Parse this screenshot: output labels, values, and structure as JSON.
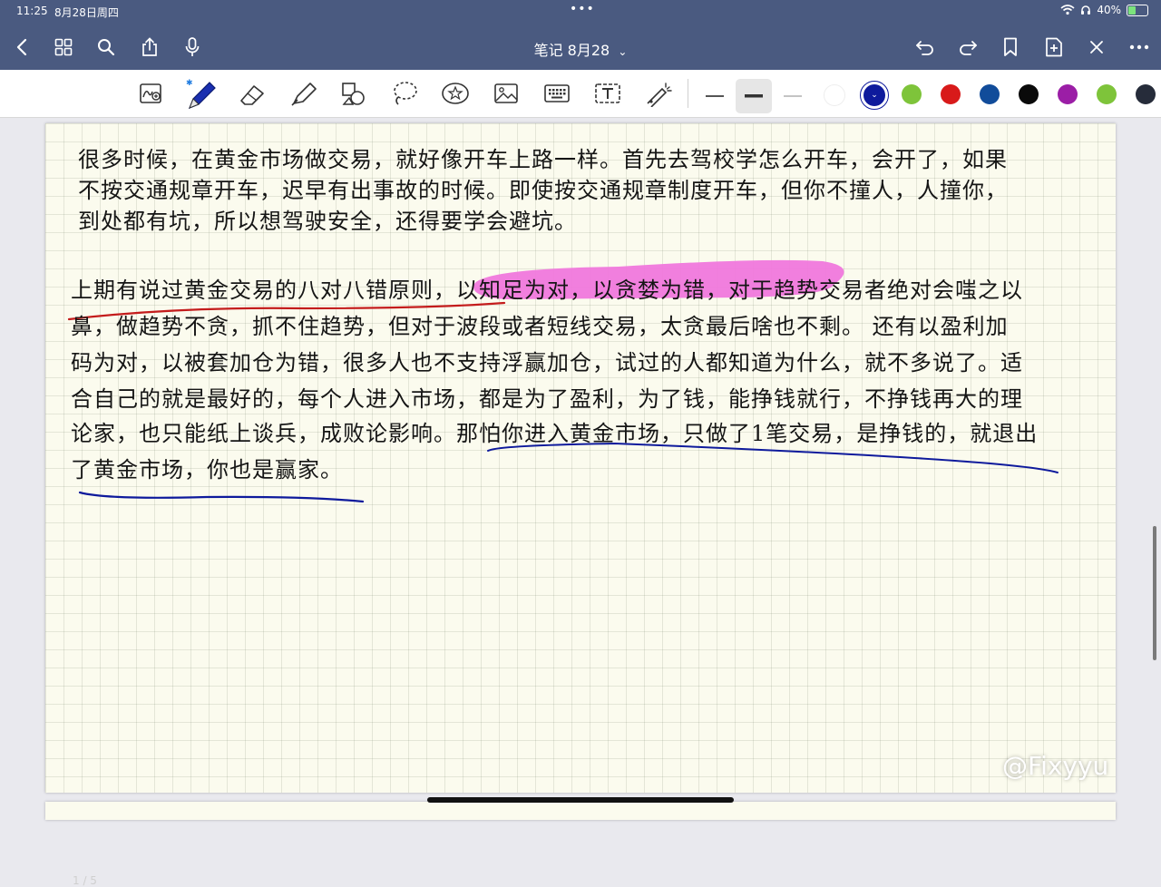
{
  "status_bar": {
    "time": "11:25",
    "date": "8月28日周四",
    "dots": "•••",
    "battery": "40%"
  },
  "nav": {
    "title": "笔记 8月28",
    "title_chevron": "⌄",
    "icons": [
      "back-icon",
      "grid-icon",
      "search-icon",
      "share-icon",
      "mic-icon",
      "undo-icon",
      "redo-icon",
      "bookmark-icon",
      "add-page-icon",
      "close-icon",
      "more-icon"
    ]
  },
  "toolbar": {
    "tools": [
      "zoom-window-icon",
      "pen-icon",
      "eraser-icon",
      "highlighter-icon",
      "shapes-icon",
      "lasso-icon",
      "sticker-icon",
      "image-icon",
      "keyboard-icon",
      "text-box-icon",
      "laser-pointer-icon"
    ],
    "colors": [
      "#ffffff",
      "#0e1a9c",
      "#7ec43a",
      "#d81a1a",
      "#114c9a",
      "#0a0a0a",
      "#9b1ea6",
      "#7ec43a",
      "#262c3a"
    ],
    "selected_color": "#0e1a9c"
  },
  "note": {
    "p1": [
      "很多时候，在黄金市场做交易，就好像开车上路一样。首先去驾校学怎么开车，会开了，如果",
      "不按交通规章开车，迟早有出事故的时候。即使按交通规章制度开车，但你不撞人，人撞你，",
      "到处都有坑，所以想驾驶安全，还得要学会避坑。"
    ],
    "p2_line1_a": "上期有说过黄金交易的八对八错原则，",
    "p2_line1_b": "以知足为对，以贪婪为错，",
    "p2_line1_c": "对于趋势交易者绝对会嗤之以",
    "p2": [
      "鼻，做趋势不贪，抓不住趋势，但对于波段或者短线交易，太贪最后啥也不剩。 还有以盈利加",
      "码为对，以被套加仓为错，很多人也不支持浮赢加仓，试过的人都知道为什么，就不多说了。适",
      "合自己的就是最好的，每个人进入市场，都是为了盈利，为了钱，能挣钱就行，不挣钱再大的理"
    ],
    "p2_line5_a": "论家，也只能纸上谈兵，成败论影响。",
    "p2_line5_b": "那怕你进入黄金市场，只做了1笔交易，是挣钱的，就退出",
    "p2_line6": "了黄金市场，你也是赢家。"
  },
  "watermark": "@Fixyyu",
  "page_num": "1 / 5"
}
